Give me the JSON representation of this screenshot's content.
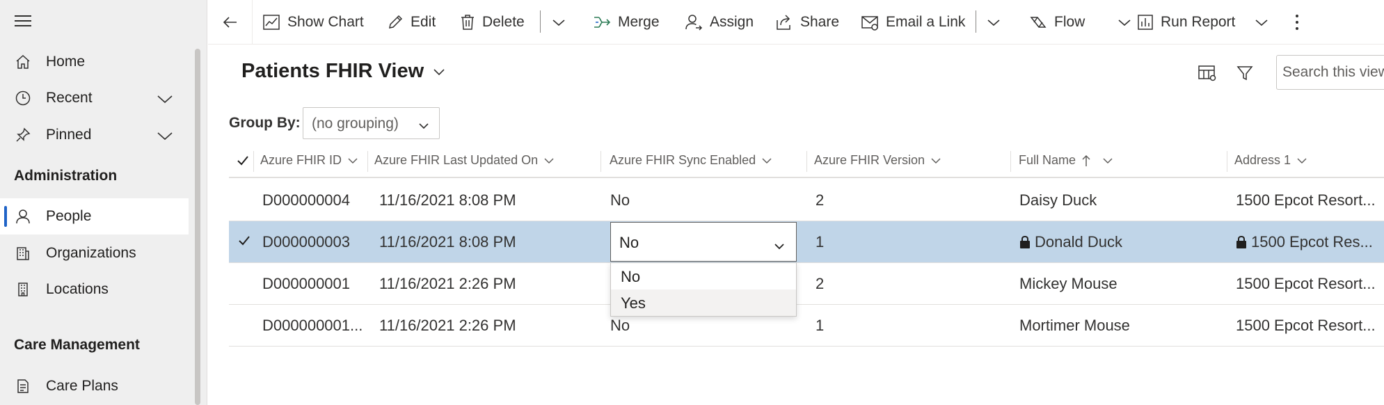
{
  "sidebar": {
    "nav": [
      {
        "label": "Home",
        "icon": "home-icon"
      },
      {
        "label": "Recent",
        "icon": "clock-icon"
      },
      {
        "label": "Pinned",
        "icon": "pin-icon"
      }
    ],
    "sections": [
      {
        "title": "Administration",
        "items": [
          {
            "label": "People",
            "icon": "person-icon",
            "selected": true
          },
          {
            "label": "Organizations",
            "icon": "building-icon"
          },
          {
            "label": "Locations",
            "icon": "location-building-icon"
          }
        ]
      },
      {
        "title": "Care Management",
        "items": [
          {
            "label": "Care Plans",
            "icon": "care-plan-icon"
          }
        ]
      }
    ]
  },
  "toolbar": {
    "show_chart": "Show Chart",
    "edit": "Edit",
    "delete": "Delete",
    "merge": "Merge",
    "assign": "Assign",
    "share": "Share",
    "email_link": "Email a Link",
    "flow": "Flow",
    "run_report": "Run Report"
  },
  "view": {
    "title": "Patients FHIR View",
    "search_placeholder": "Search this view",
    "group_by_label": "Group By:",
    "group_by_value": "(no grouping)"
  },
  "grid": {
    "columns": [
      "Azure FHIR ID",
      "Azure FHIR Last Updated On",
      "Azure FHIR Sync Enabled",
      "Azure FHIR Version",
      "Full Name",
      "Address 1"
    ],
    "sorted_column": "Full Name",
    "sort_direction": "ascending",
    "rows": [
      {
        "id": "D000000004",
        "updated": "11/16/2021 8:08 PM",
        "sync": "No",
        "version": "2",
        "name": "Daisy Duck",
        "address": "1500 Epcot Resort..."
      },
      {
        "id": "D000000003",
        "updated": "11/16/2021 8:08 PM",
        "sync": "No",
        "version": "1",
        "name": "Donald Duck",
        "address": "1500 Epcot Res...",
        "selected": true,
        "locked": true
      },
      {
        "id": "D000000001",
        "updated": "11/16/2021 2:26 PM",
        "sync": "",
        "version": "2",
        "name": "Mickey Mouse",
        "address": "1500 Epcot Resort..."
      },
      {
        "id": "D000000001...",
        "updated": "11/16/2021 2:26 PM",
        "sync": "No",
        "version": "1",
        "name": "Mortimer Mouse",
        "address": "1500 Epcot Resort..."
      }
    ]
  },
  "sync_editor": {
    "value": "No",
    "options": [
      "No",
      "Yes"
    ],
    "highlighted_option": "Yes"
  },
  "colors": {
    "selected_row": "#c0d5e8",
    "accent": "#1f63c7",
    "sidebar_bg": "#efefef"
  }
}
